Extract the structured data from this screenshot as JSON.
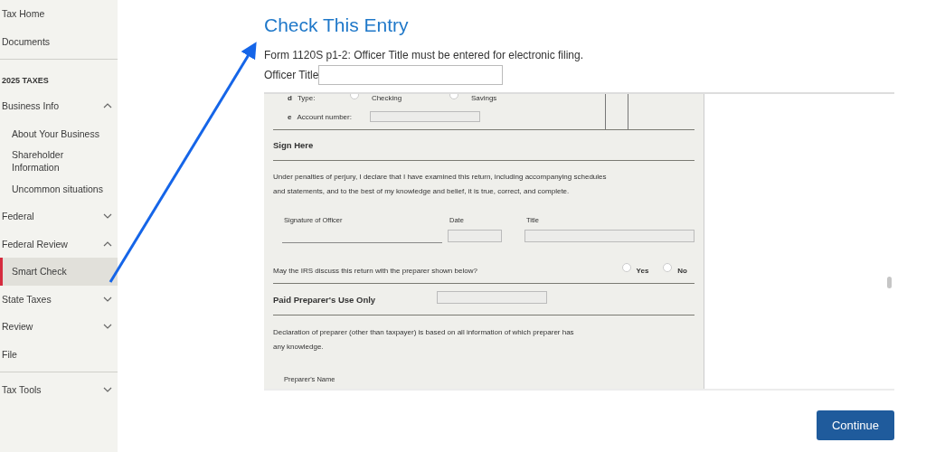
{
  "sidebar": {
    "items": [
      {
        "kind": "link",
        "label": "Tax Home"
      },
      {
        "kind": "link",
        "label": "Documents"
      },
      {
        "kind": "divider"
      },
      {
        "kind": "heading",
        "label": "2025 TAXES"
      },
      {
        "kind": "group",
        "label": "Business Info",
        "expanded": true,
        "children": [
          {
            "label": "About Your Business",
            "selected": false
          },
          {
            "label": "Shareholder Information",
            "selected": false
          },
          {
            "label": "Uncommon situations",
            "selected": false
          }
        ]
      },
      {
        "kind": "group",
        "label": "Federal",
        "expanded": false
      },
      {
        "kind": "group",
        "label": "Federal Review",
        "expanded": true,
        "children": [
          {
            "label": "Smart Check",
            "selected": true
          }
        ]
      },
      {
        "kind": "group",
        "label": "State Taxes",
        "expanded": false
      },
      {
        "kind": "group",
        "label": "Review",
        "expanded": false
      },
      {
        "kind": "link",
        "label": "File"
      },
      {
        "kind": "divider"
      },
      {
        "kind": "group",
        "label": "Tax Tools",
        "expanded": false
      }
    ]
  },
  "main": {
    "title": "Check This Entry",
    "message": "Form 1120S p1-2: Officer Title must be entered for electronic filing.",
    "field_label": "Officer Title"
  },
  "form": {
    "type_row": {
      "letter": "d",
      "label": "Type:",
      "options": [
        {
          "label": "Checking",
          "selected": false
        },
        {
          "label": "Savings",
          "selected": false
        }
      ]
    },
    "account_row": {
      "letter": "e",
      "label": "Account number:"
    },
    "sign_heading": "Sign Here",
    "declaration": [
      "Under penalties of perjury, I declare that I have examined this return, including accompanying schedules",
      "and statements, and to the best of my knowledge and belief, it is true, correct, and complete."
    ],
    "signature_labels": [
      "Signature of Officer",
      "Date",
      "Title"
    ],
    "irs_question": "May the IRS discuss this return with the preparer shown below?",
    "irs_options": [
      {
        "label": "Yes",
        "selected": false
      },
      {
        "label": "No",
        "selected": false
      }
    ],
    "preparer_heading": "Paid Preparer's Use Only",
    "preparer_declaration": [
      "Declaration of preparer (other than taxpayer) is based on all information of which preparer has",
      "any knowledge."
    ],
    "preparer_name_label": "Preparer's Name"
  },
  "continue_button": "Continue"
}
